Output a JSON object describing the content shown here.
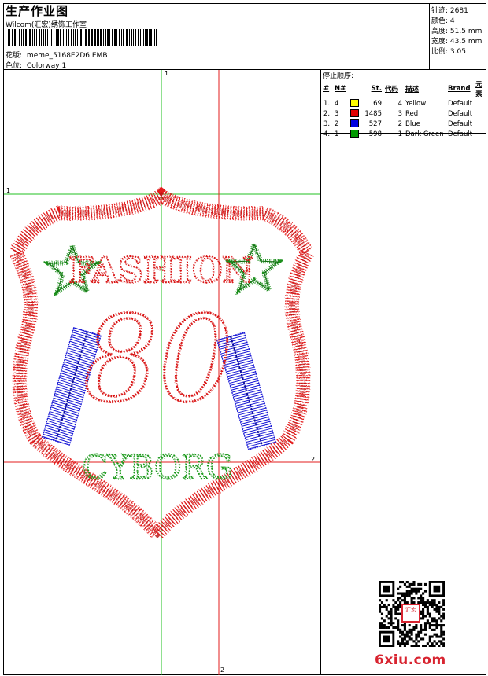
{
  "header": {
    "title": "生产作业图",
    "company": "Wilcom(汇宏)绣饰工作室",
    "design_label": "花版:",
    "design_value": "meme_5168E2D6.EMB",
    "colorway_label": "色位:",
    "colorway_value": "Colorway 1"
  },
  "specs": [
    {
      "label": "针迹:",
      "value": "2681"
    },
    {
      "label": "颜色:",
      "value": "4"
    },
    {
      "label": "高度:",
      "value": "51.5 mm"
    },
    {
      "label": "宽度:",
      "value": "43.5 mm"
    },
    {
      "label": "比例:",
      "value": "3.05"
    }
  ],
  "stop_sequence": {
    "title": "停止顺序:",
    "headers": {
      "num": "#",
      "n": "N#",
      "color": "",
      "st": "St.",
      "code": "代码",
      "desc": "描述",
      "brand": "Brand",
      "element": "元素"
    },
    "rows": [
      {
        "num": "1.",
        "n": "4",
        "color": "#ffff00",
        "st": "69",
        "code": "4",
        "desc": "Yellow",
        "brand": "Default"
      },
      {
        "num": "2.",
        "n": "3",
        "color": "#e00000",
        "st": "1485",
        "code": "3",
        "desc": "Red",
        "brand": "Default"
      },
      {
        "num": "3.",
        "n": "2",
        "color": "#0000e0",
        "st": "527",
        "code": "2",
        "desc": "Blue",
        "brand": "Default"
      },
      {
        "num": "4.",
        "n": "1",
        "color": "#009900",
        "st": "598",
        "code": "1",
        "desc": "Dark Green",
        "brand": "Default"
      }
    ]
  },
  "design": {
    "text_top": "FASHION",
    "text_mid": "80",
    "text_bottom": "CYBORG",
    "colors": {
      "outline": "#e31d1d",
      "text": "#d91616",
      "stars": "#1b8f1b",
      "bars": "#1818d6",
      "bottom_text": "#1c9a1c"
    }
  },
  "guides": {
    "green_v_label": "1",
    "green_h_label": "1",
    "red_h_label": "2",
    "red_v_label": "2"
  },
  "watermark": {
    "text": "6xiu.com",
    "stamp": "汇宏"
  }
}
